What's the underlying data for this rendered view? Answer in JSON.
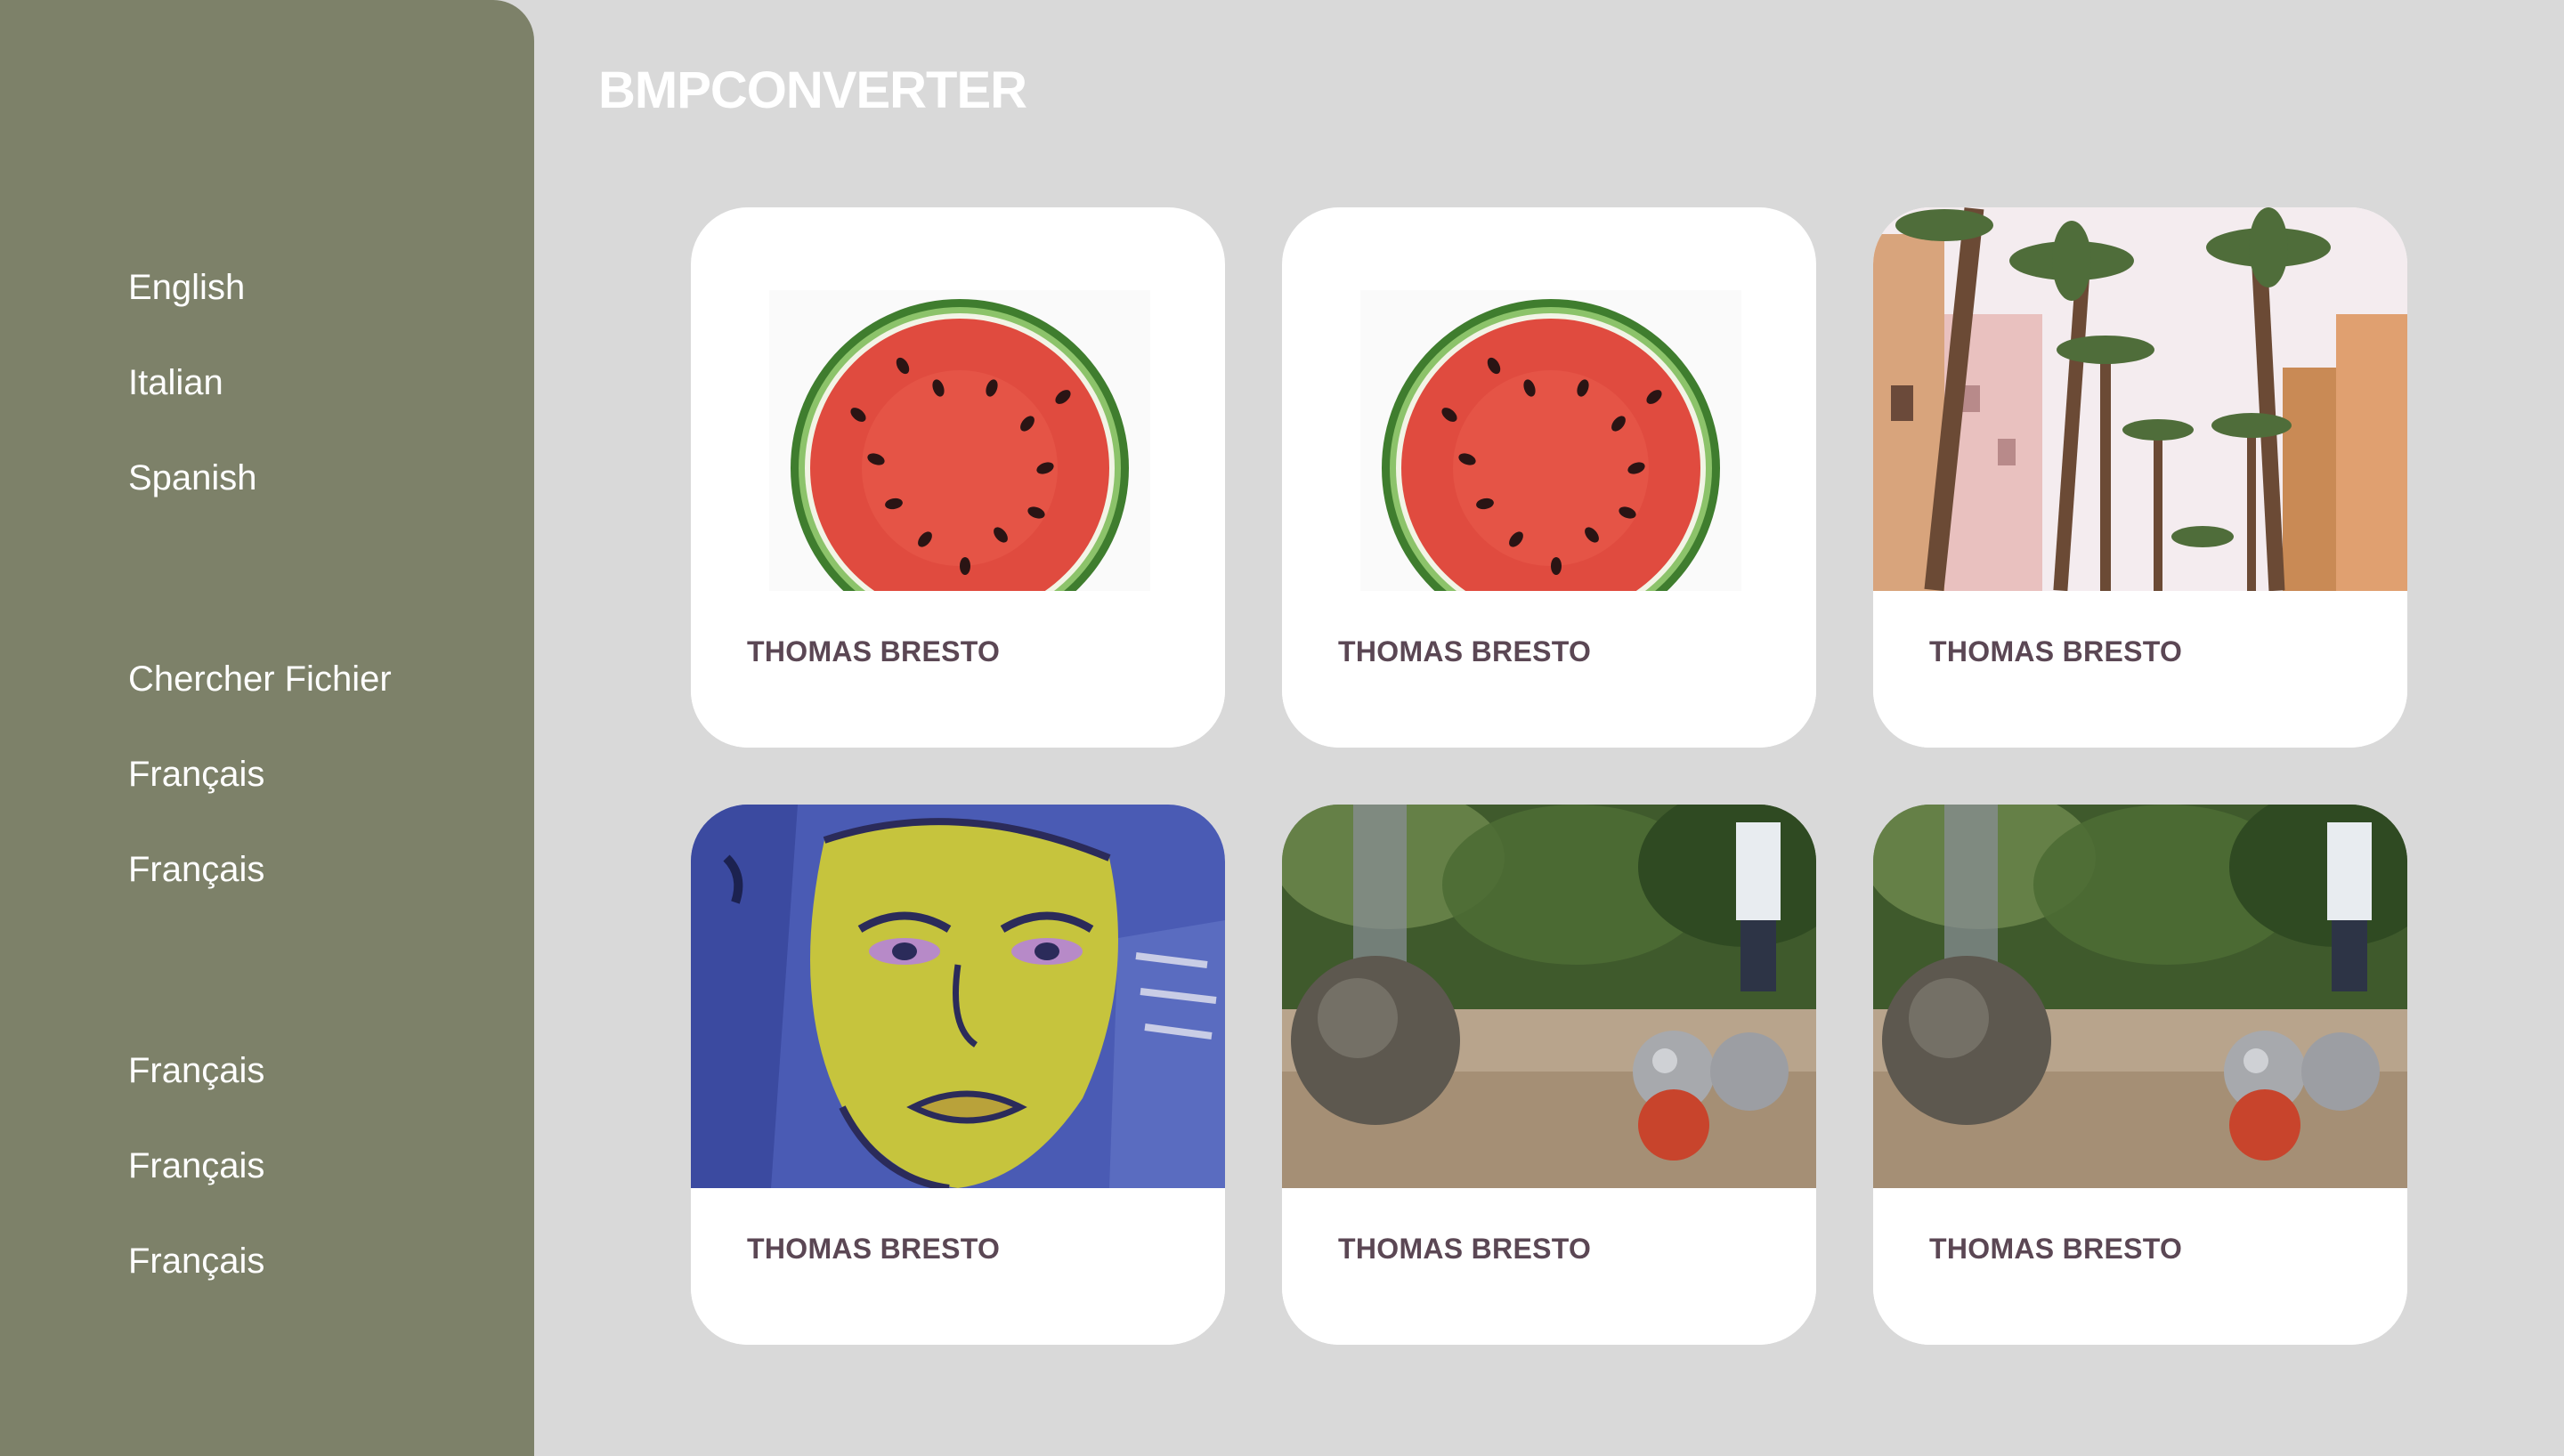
{
  "app": {
    "title": "BMPCONVERTER"
  },
  "sidebar": {
    "group1": [
      {
        "label": "English"
      },
      {
        "label": "Italian"
      },
      {
        "label": "Spanish"
      }
    ],
    "group2": [
      {
        "label": "Chercher Fichier"
      },
      {
        "label": "Français"
      },
      {
        "label": "Français"
      }
    ],
    "group3": [
      {
        "label": "Français"
      },
      {
        "label": "Français"
      },
      {
        "label": "Français"
      }
    ]
  },
  "cards": [
    {
      "image": "watermelon-slice",
      "author": "THOMAS BRESTO"
    },
    {
      "image": "watermelon-slice",
      "author": "THOMAS BRESTO"
    },
    {
      "image": "palm-trees-street",
      "author": "THOMAS BRESTO"
    },
    {
      "image": "painted-face-portrait",
      "author": "THOMAS BRESTO"
    },
    {
      "image": "petanque-boules",
      "author": "THOMAS BRESTO"
    },
    {
      "image": "petanque-boules",
      "author": "THOMAS BRESTO"
    }
  ],
  "colors": {
    "sidebar": "#7d8169",
    "background": "#d9d9d9",
    "card": "#ffffff",
    "author_text": "#5b4754"
  }
}
